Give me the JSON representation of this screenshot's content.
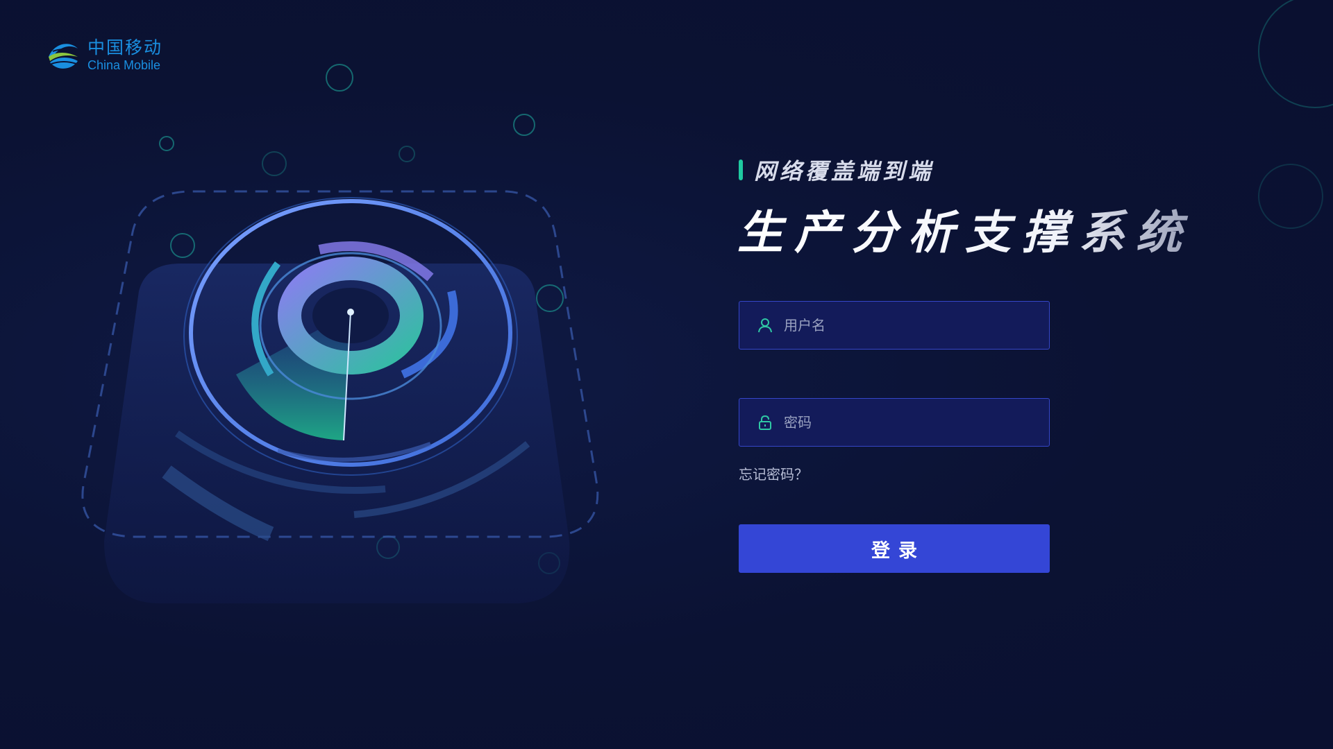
{
  "brand": {
    "name_cn": "中国移动",
    "name_en": "China Mobile"
  },
  "header": {
    "subtitle": "网络覆盖端到端",
    "title": "生产分析支撑系统"
  },
  "login_form": {
    "username_placeholder": "用户名",
    "username_value": "",
    "password_placeholder": "密码",
    "password_value": "",
    "forgot_password_label": "忘记密码？",
    "submit_label": "登录"
  },
  "icons": {
    "username": "user-icon",
    "password": "lock-icon"
  },
  "colors": {
    "background": "#0b1233",
    "accent": "#1fc9a0",
    "brand_blue": "#1a8fe0",
    "button": "#3446d6",
    "field_border": "#3546c9",
    "field_bg": "#131b5a"
  }
}
